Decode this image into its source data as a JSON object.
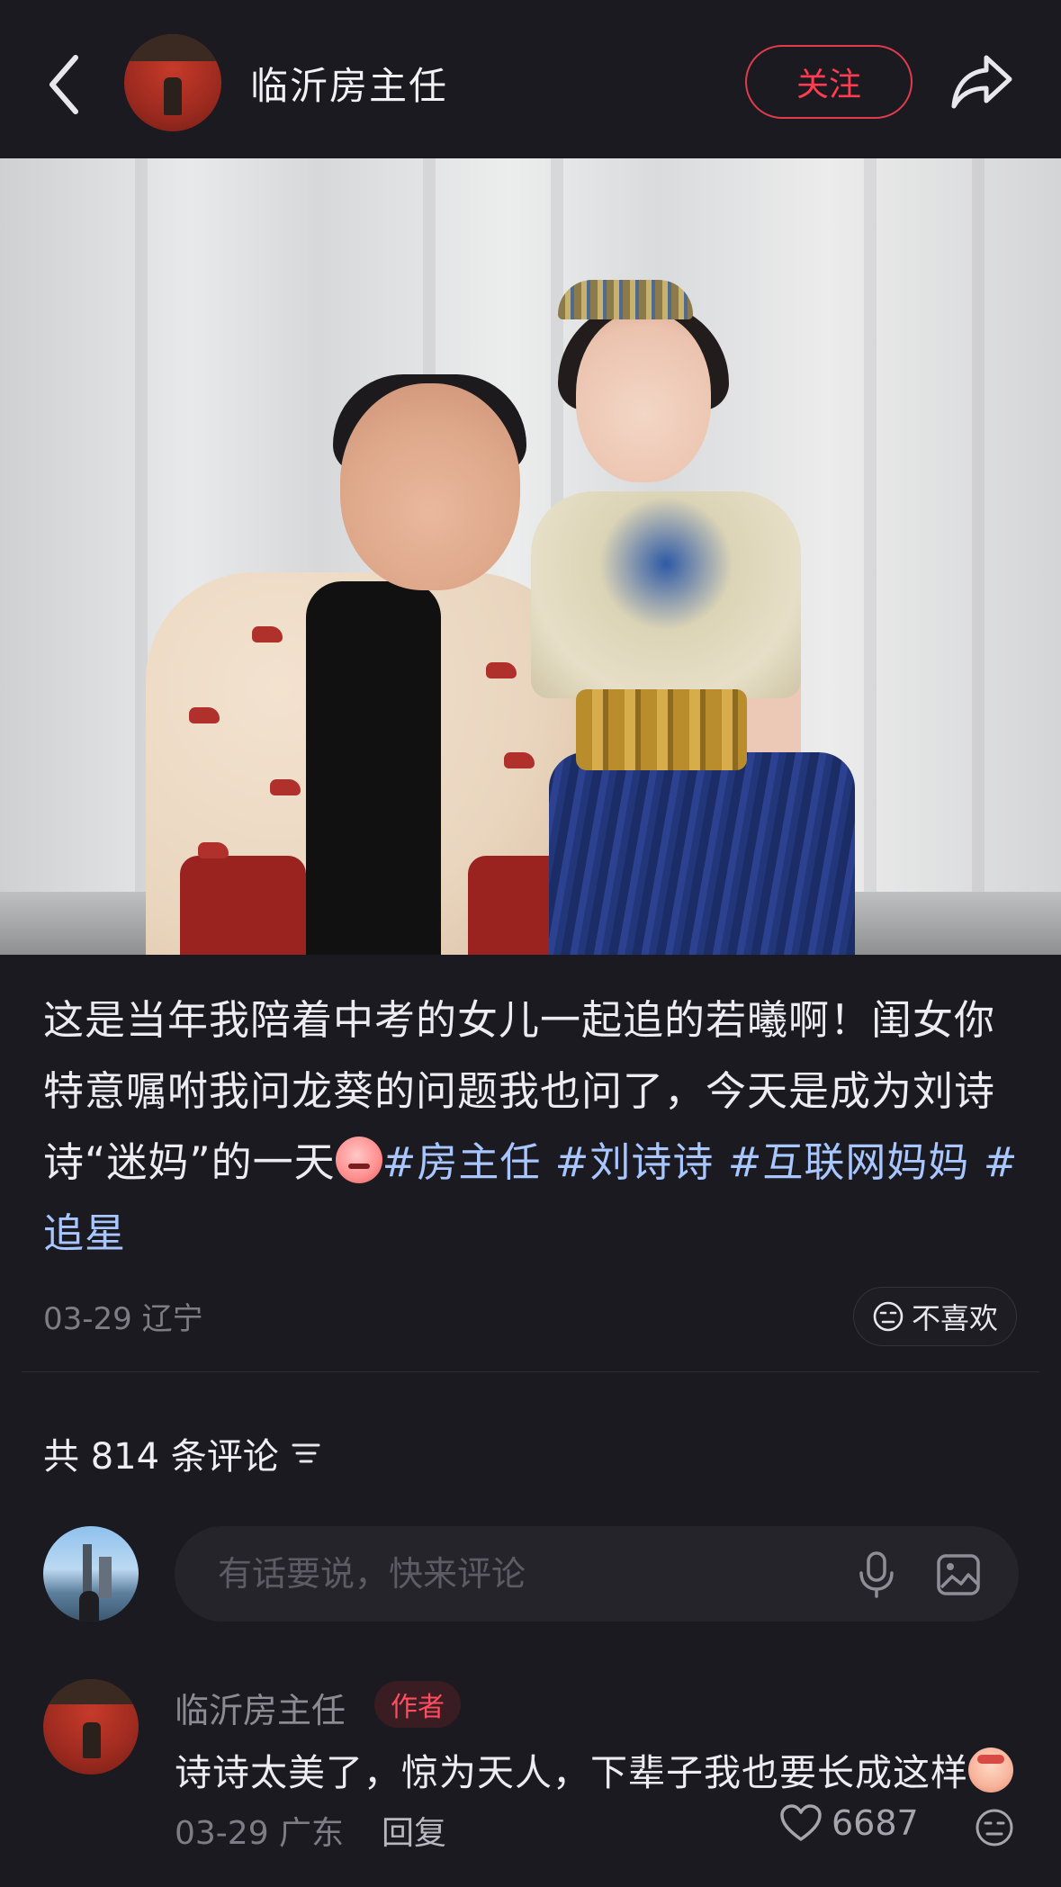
{
  "header": {
    "username": "临沂房主任",
    "follow_label": "关注"
  },
  "post": {
    "caption_part1": "这是当年我陪着中考的女儿一起追的若曦啊！闺女你特意嘱咐我问龙葵的问题我也问了，今天是成为刘诗诗“迷妈”的一天",
    "tags": [
      "#房主任",
      "#刘诗诗",
      "#互联网妈妈",
      "#追星"
    ],
    "date_location": "03-29 辽宁",
    "dislike_label": "不喜欢"
  },
  "comments_section": {
    "count_label": "共 814 条评论",
    "input_placeholder": "有话要说，快来评论"
  },
  "comment": {
    "username": "临沂房主任",
    "badge": "作者",
    "text": "诗诗太美了，惊为天人，下辈子我也要长成这样",
    "date_location": "03-29 广东",
    "reply_label": "回复",
    "likes": "6687"
  },
  "colors": {
    "background": "#1b1a20",
    "accent_red": "#ff3c50",
    "hashtag_blue": "#a8c6ff"
  },
  "icons": [
    "back-arrow-icon",
    "share-icon",
    "dislike-face-icon",
    "sort-icon",
    "mic-icon",
    "image-icon",
    "heart-icon"
  ]
}
